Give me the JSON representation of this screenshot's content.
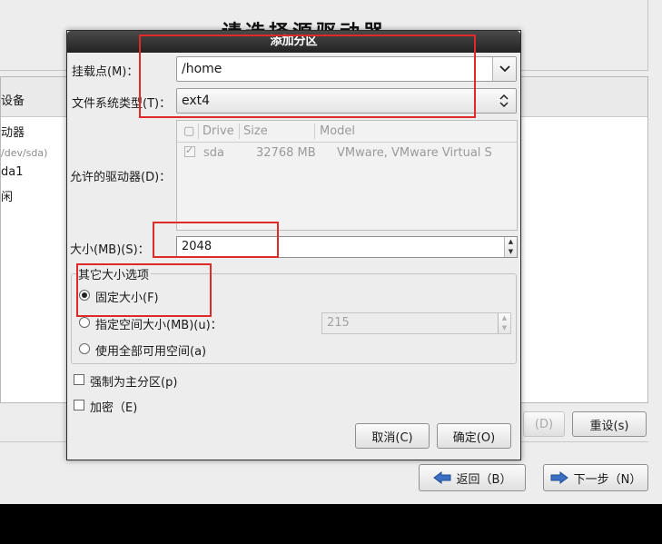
{
  "background": {
    "heading": "请选择源驱动器",
    "tree_header": "设备",
    "tree_rows": [
      "动器",
      "/dev/sda)",
      "da1",
      "闲"
    ],
    "buttons": {
      "delete": "(D)",
      "reset": "重设(s)",
      "back": "返回（B）",
      "next": "下一步（N）"
    }
  },
  "dialog": {
    "title": "添加分区",
    "mount_point": {
      "label": "挂载点(M)：",
      "value": "/home"
    },
    "fs_type": {
      "label": "文件系统类型(T)：",
      "value": "ext4"
    },
    "allowed_drives": {
      "label": "允许的驱动器(D)：",
      "columns": [
        "Drive",
        "Size",
        "Model"
      ],
      "rows": [
        {
          "drive": "sda",
          "size": "32768 MB",
          "model": "VMware, VMware Virtual S"
        }
      ]
    },
    "size": {
      "label": "大小(MB)(S)：",
      "value": "2048"
    },
    "size_options": {
      "legend": "其它大小选项",
      "fixed": "固定大小(F)",
      "up_to": "指定空间大小(MB)(u)：",
      "up_to_value": "215",
      "fill_all": "使用全部可用空间(a)"
    },
    "force_primary": "强制为主分区(p)",
    "encrypt": "加密（E)",
    "cancel": "取消(C)",
    "ok": "确定(O)"
  },
  "colors": {
    "annotation": "#e02a2a",
    "title_bar": "#222222",
    "dialog_bg": "#ededed"
  }
}
